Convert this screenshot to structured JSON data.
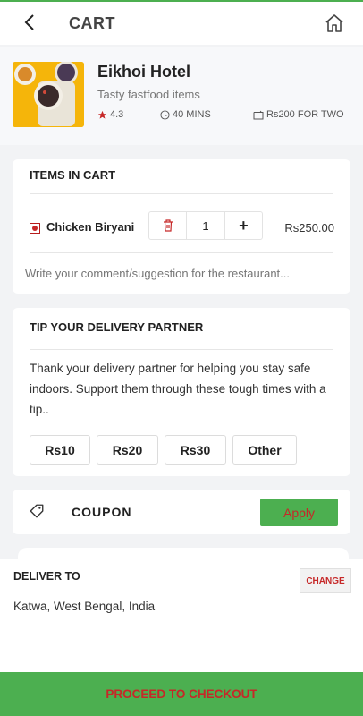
{
  "header": {
    "title": "CART"
  },
  "restaurant": {
    "name": "Eikhoi Hotel",
    "subtitle": "Tasty fastfood items",
    "rating": "4.3",
    "time": "40 MINS",
    "cost": "Rs200 FOR TWO"
  },
  "cart": {
    "heading": "ITEMS IN CART",
    "items": [
      {
        "name": "Chicken Biryani",
        "quantity": "1",
        "plus": "+",
        "price": "Rs250.00"
      }
    ],
    "comment_placeholder": "Write your comment/suggestion for the restaurant..."
  },
  "tip": {
    "heading": "TIP YOUR DELIVERY PARTNER",
    "text": "Thank your delivery partner for helping you stay safe indoors. Support them through these tough times with a tip..",
    "options": [
      "Rs10",
      "Rs20",
      "Rs30",
      "Other"
    ]
  },
  "coupon": {
    "label": "COUPON",
    "apply_label": "Apply"
  },
  "delivery": {
    "title": "DELIVER TO",
    "change_label": "CHANGE",
    "address": "Katwa, West Bengal, India"
  },
  "checkout": {
    "label": "PROCEED TO CHECKOUT"
  },
  "colors": {
    "accent": "#4caf50",
    "action_text": "#c62828"
  }
}
